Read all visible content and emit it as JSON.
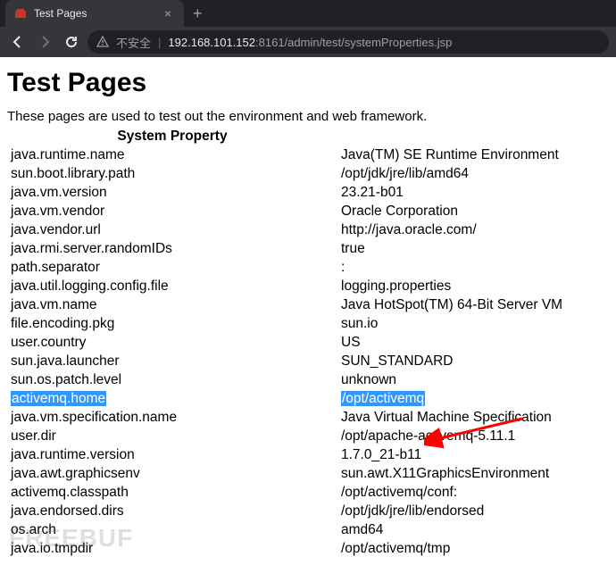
{
  "browser": {
    "tab_title": "Test Pages",
    "insecure_label": "不安全",
    "url_host": "192.168.101.152",
    "url_port_path": ":8161/admin/test/systemProperties.jsp"
  },
  "page": {
    "heading": "Test Pages",
    "intro": "These pages are used to test out the environment and web framework.",
    "col1_header": "System Property",
    "col2_header": "",
    "rows": [
      {
        "key": "java.runtime.name",
        "val": "Java(TM) SE Runtime Environment"
      },
      {
        "key": "sun.boot.library.path",
        "val": "/opt/jdk/jre/lib/amd64"
      },
      {
        "key": "java.vm.version",
        "val": "23.21-b01"
      },
      {
        "key": "java.vm.vendor",
        "val": "Oracle Corporation"
      },
      {
        "key": "java.vendor.url",
        "val": "http://java.oracle.com/"
      },
      {
        "key": "java.rmi.server.randomIDs",
        "val": "true"
      },
      {
        "key": "path.separator",
        "val": ":"
      },
      {
        "key": "java.util.logging.config.file",
        "val": "logging.properties"
      },
      {
        "key": "java.vm.name",
        "val": "Java HotSpot(TM) 64-Bit Server VM"
      },
      {
        "key": "file.encoding.pkg",
        "val": "sun.io"
      },
      {
        "key": "user.country",
        "val": "US"
      },
      {
        "key": "sun.java.launcher",
        "val": "SUN_STANDARD"
      },
      {
        "key": "sun.os.patch.level",
        "val": "unknown"
      },
      {
        "key": "activemq.home",
        "val": "/opt/activemq",
        "highlight": true
      },
      {
        "key": "java.vm.specification.name",
        "val": "Java Virtual Machine Specification"
      },
      {
        "key": "user.dir",
        "val": "/opt/apache-activemq-5.11.1"
      },
      {
        "key": "java.runtime.version",
        "val": "1.7.0_21-b11"
      },
      {
        "key": "java.awt.graphicsenv",
        "val": "sun.awt.X11GraphicsEnvironment"
      },
      {
        "key": "activemq.classpath",
        "val": "/opt/activemq/conf:"
      },
      {
        "key": "java.endorsed.dirs",
        "val": "/opt/jdk/jre/lib/endorsed"
      },
      {
        "key": "os.arch",
        "val": "amd64"
      },
      {
        "key": "java.io.tmpdir",
        "val": "/opt/activemq/tmp"
      }
    ]
  },
  "watermark": "FREEBUF"
}
